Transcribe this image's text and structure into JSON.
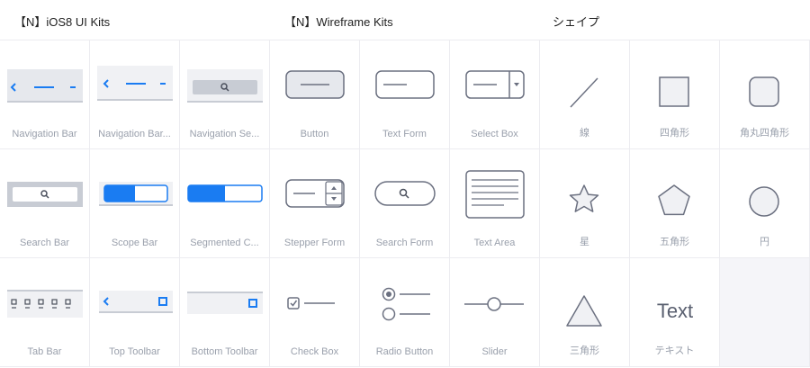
{
  "header": {
    "kit1": "【N】iOS8 UI Kits",
    "kit2": "【N】Wireframe Kits",
    "kit3": "シェイプ"
  },
  "cells": [
    {
      "label": "Navigation Bar",
      "icon": "navigation-bar-icon"
    },
    {
      "label": "Navigation Bar...",
      "icon": "navigation-bar-alt-icon"
    },
    {
      "label": "Navigation Se...",
      "icon": "navigation-search-icon"
    },
    {
      "label": "Button",
      "icon": "button-icon"
    },
    {
      "label": "Text Form",
      "icon": "text-form-icon"
    },
    {
      "label": "Select Box",
      "icon": "select-box-icon"
    },
    {
      "label": "線",
      "icon": "line-icon"
    },
    {
      "label": "四角形",
      "icon": "square-icon"
    },
    {
      "label": "角丸四角形",
      "icon": "rounded-square-icon"
    },
    {
      "label": "Search Bar",
      "icon": "search-bar-icon"
    },
    {
      "label": "Scope Bar",
      "icon": "scope-bar-icon"
    },
    {
      "label": "Segmented C...",
      "icon": "segmented-control-icon"
    },
    {
      "label": "Stepper Form",
      "icon": "stepper-form-icon"
    },
    {
      "label": "Search Form",
      "icon": "search-form-icon"
    },
    {
      "label": "Text Area",
      "icon": "text-area-icon"
    },
    {
      "label": "星",
      "icon": "star-icon"
    },
    {
      "label": "五角形",
      "icon": "pentagon-icon"
    },
    {
      "label": "円",
      "icon": "circle-icon"
    },
    {
      "label": "Tab Bar",
      "icon": "tab-bar-icon"
    },
    {
      "label": "Top Toolbar",
      "icon": "top-toolbar-icon"
    },
    {
      "label": "Bottom Toolbar",
      "icon": "bottom-toolbar-icon"
    },
    {
      "label": "Check Box",
      "icon": "check-box-icon"
    },
    {
      "label": "Radio Button",
      "icon": "radio-button-icon"
    },
    {
      "label": "Slider",
      "icon": "slider-icon"
    },
    {
      "label": "三角形",
      "icon": "triangle-icon"
    },
    {
      "label": "テキスト",
      "icon": "text-icon",
      "glyph": "Text"
    }
  ],
  "colors": {
    "accent": "#1a7cf2",
    "stroke": "#6b7080",
    "bar_fill": "#e6e8ed",
    "empty_cell": "#f5f5f9"
  }
}
